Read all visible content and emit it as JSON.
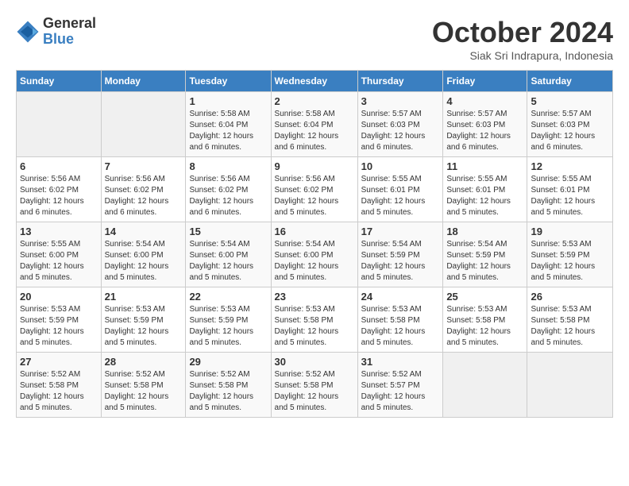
{
  "logo": {
    "general": "General",
    "blue": "Blue"
  },
  "title": "October 2024",
  "subtitle": "Siak Sri Indrapura, Indonesia",
  "headers": [
    "Sunday",
    "Monday",
    "Tuesday",
    "Wednesday",
    "Thursday",
    "Friday",
    "Saturday"
  ],
  "weeks": [
    [
      {
        "day": "",
        "info": ""
      },
      {
        "day": "",
        "info": ""
      },
      {
        "day": "1",
        "info": "Sunrise: 5:58 AM\nSunset: 6:04 PM\nDaylight: 12 hours and 6 minutes."
      },
      {
        "day": "2",
        "info": "Sunrise: 5:58 AM\nSunset: 6:04 PM\nDaylight: 12 hours and 6 minutes."
      },
      {
        "day": "3",
        "info": "Sunrise: 5:57 AM\nSunset: 6:03 PM\nDaylight: 12 hours and 6 minutes."
      },
      {
        "day": "4",
        "info": "Sunrise: 5:57 AM\nSunset: 6:03 PM\nDaylight: 12 hours and 6 minutes."
      },
      {
        "day": "5",
        "info": "Sunrise: 5:57 AM\nSunset: 6:03 PM\nDaylight: 12 hours and 6 minutes."
      }
    ],
    [
      {
        "day": "6",
        "info": "Sunrise: 5:56 AM\nSunset: 6:02 PM\nDaylight: 12 hours and 6 minutes."
      },
      {
        "day": "7",
        "info": "Sunrise: 5:56 AM\nSunset: 6:02 PM\nDaylight: 12 hours and 6 minutes."
      },
      {
        "day": "8",
        "info": "Sunrise: 5:56 AM\nSunset: 6:02 PM\nDaylight: 12 hours and 6 minutes."
      },
      {
        "day": "9",
        "info": "Sunrise: 5:56 AM\nSunset: 6:02 PM\nDaylight: 12 hours and 5 minutes."
      },
      {
        "day": "10",
        "info": "Sunrise: 5:55 AM\nSunset: 6:01 PM\nDaylight: 12 hours and 5 minutes."
      },
      {
        "day": "11",
        "info": "Sunrise: 5:55 AM\nSunset: 6:01 PM\nDaylight: 12 hours and 5 minutes."
      },
      {
        "day": "12",
        "info": "Sunrise: 5:55 AM\nSunset: 6:01 PM\nDaylight: 12 hours and 5 minutes."
      }
    ],
    [
      {
        "day": "13",
        "info": "Sunrise: 5:55 AM\nSunset: 6:00 PM\nDaylight: 12 hours and 5 minutes."
      },
      {
        "day": "14",
        "info": "Sunrise: 5:54 AM\nSunset: 6:00 PM\nDaylight: 12 hours and 5 minutes."
      },
      {
        "day": "15",
        "info": "Sunrise: 5:54 AM\nSunset: 6:00 PM\nDaylight: 12 hours and 5 minutes."
      },
      {
        "day": "16",
        "info": "Sunrise: 5:54 AM\nSunset: 6:00 PM\nDaylight: 12 hours and 5 minutes."
      },
      {
        "day": "17",
        "info": "Sunrise: 5:54 AM\nSunset: 5:59 PM\nDaylight: 12 hours and 5 minutes."
      },
      {
        "day": "18",
        "info": "Sunrise: 5:54 AM\nSunset: 5:59 PM\nDaylight: 12 hours and 5 minutes."
      },
      {
        "day": "19",
        "info": "Sunrise: 5:53 AM\nSunset: 5:59 PM\nDaylight: 12 hours and 5 minutes."
      }
    ],
    [
      {
        "day": "20",
        "info": "Sunrise: 5:53 AM\nSunset: 5:59 PM\nDaylight: 12 hours and 5 minutes."
      },
      {
        "day": "21",
        "info": "Sunrise: 5:53 AM\nSunset: 5:59 PM\nDaylight: 12 hours and 5 minutes."
      },
      {
        "day": "22",
        "info": "Sunrise: 5:53 AM\nSunset: 5:59 PM\nDaylight: 12 hours and 5 minutes."
      },
      {
        "day": "23",
        "info": "Sunrise: 5:53 AM\nSunset: 5:58 PM\nDaylight: 12 hours and 5 minutes."
      },
      {
        "day": "24",
        "info": "Sunrise: 5:53 AM\nSunset: 5:58 PM\nDaylight: 12 hours and 5 minutes."
      },
      {
        "day": "25",
        "info": "Sunrise: 5:53 AM\nSunset: 5:58 PM\nDaylight: 12 hours and 5 minutes."
      },
      {
        "day": "26",
        "info": "Sunrise: 5:53 AM\nSunset: 5:58 PM\nDaylight: 12 hours and 5 minutes."
      }
    ],
    [
      {
        "day": "27",
        "info": "Sunrise: 5:52 AM\nSunset: 5:58 PM\nDaylight: 12 hours and 5 minutes."
      },
      {
        "day": "28",
        "info": "Sunrise: 5:52 AM\nSunset: 5:58 PM\nDaylight: 12 hours and 5 minutes."
      },
      {
        "day": "29",
        "info": "Sunrise: 5:52 AM\nSunset: 5:58 PM\nDaylight: 12 hours and 5 minutes."
      },
      {
        "day": "30",
        "info": "Sunrise: 5:52 AM\nSunset: 5:58 PM\nDaylight: 12 hours and 5 minutes."
      },
      {
        "day": "31",
        "info": "Sunrise: 5:52 AM\nSunset: 5:57 PM\nDaylight: 12 hours and 5 minutes."
      },
      {
        "day": "",
        "info": ""
      },
      {
        "day": "",
        "info": ""
      }
    ]
  ]
}
